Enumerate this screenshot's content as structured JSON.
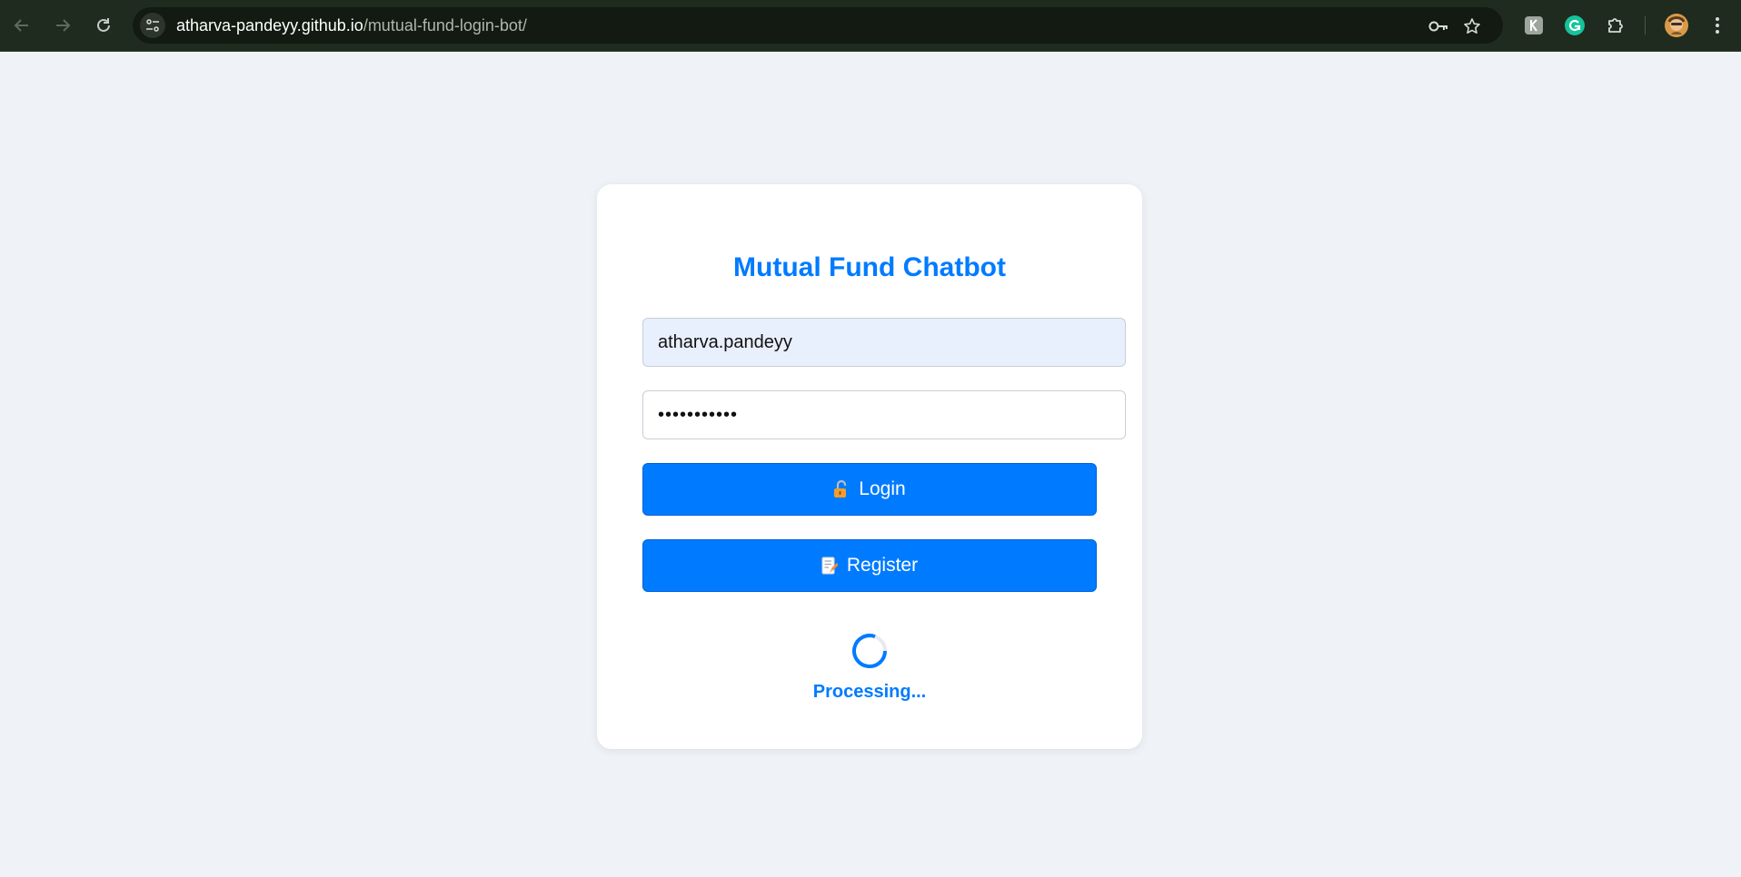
{
  "browser": {
    "url_host": "atharva-pandeyy.github.io",
    "url_path": "/mutual-fund-login-bot/",
    "icons": {
      "back": "back-arrow-icon",
      "forward": "forward-arrow-icon",
      "reload": "reload-icon",
      "site_info": "site-settings-icon",
      "password": "key-icon",
      "bookmark": "star-icon",
      "extension_1": "extension-k-icon",
      "extension_2": "grammarly-icon",
      "extensions": "puzzle-icon",
      "profile": "avatar",
      "menu": "kebab-menu-icon"
    }
  },
  "login": {
    "title": "Mutual Fund Chatbot",
    "username_value": "atharva.pandeyy",
    "password_value": "•••••••••••",
    "login_label": "Login",
    "register_label": "Register",
    "status_text": "Processing..."
  },
  "colors": {
    "accent": "#007bff",
    "page_background": "#eff2f7",
    "browser_bar": "#1f2b1e"
  }
}
